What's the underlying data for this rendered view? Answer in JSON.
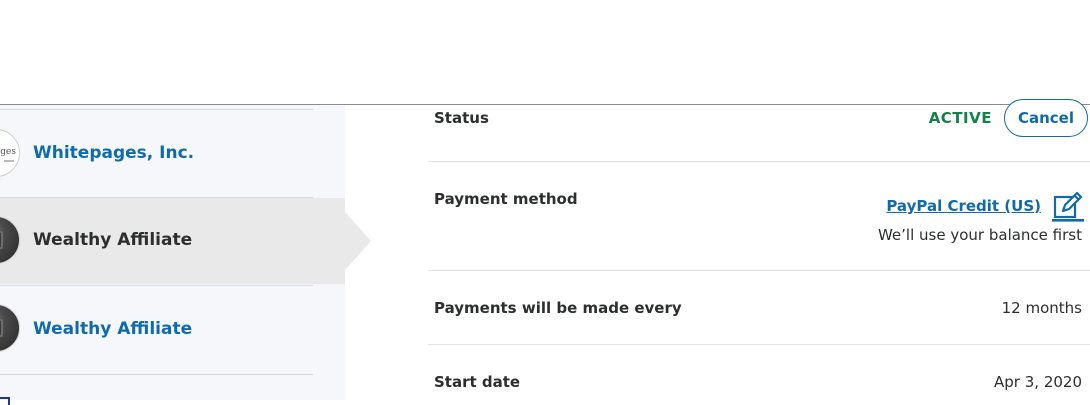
{
  "sidebar": {
    "items": [
      {
        "label": "Whitepages, Inc.",
        "logo_text": "ages",
        "state": "link"
      },
      {
        "label": "Wealthy Affiliate",
        "state": "selected"
      },
      {
        "label": "Wealthy Affiliate",
        "state": "link"
      }
    ]
  },
  "details": {
    "status": {
      "label": "Status",
      "value": "ACTIVE",
      "cancel_label": "Cancel"
    },
    "payment_method": {
      "label": "Payment method",
      "value": "PayPal Credit (US)",
      "note": "We’ll use your balance first"
    },
    "frequency": {
      "label": "Payments will be made every",
      "value": "12 months"
    },
    "start_date": {
      "label": "Start date",
      "value": "Apr 3, 2020"
    }
  },
  "colors": {
    "link": "#0f6bab",
    "active": "#14804a",
    "text": "#2c2e2f",
    "sidebar_bg": "#f5f7fa",
    "selected_bg": "#e9e9ea"
  }
}
